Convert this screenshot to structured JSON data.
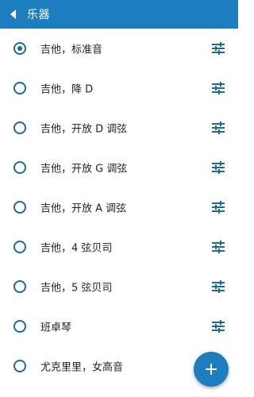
{
  "appbar": {
    "title": "乐器",
    "back_icon": "back-arrow-icon",
    "background": "#1c7dbf"
  },
  "instruments": [
    {
      "label": "吉他，标准音",
      "selected": true
    },
    {
      "label": "吉他，降 D",
      "selected": false
    },
    {
      "label": "吉他，开放 D 调弦",
      "selected": false
    },
    {
      "label": "吉他，开放 G 调弦",
      "selected": false
    },
    {
      "label": "吉他，开放 A 调弦",
      "selected": false
    },
    {
      "label": "吉他，4 弦贝司",
      "selected": false
    },
    {
      "label": "吉他，5 弦贝司",
      "selected": false
    },
    {
      "label": "班卓琴",
      "selected": false
    },
    {
      "label": "尤克里里，女高音",
      "selected": false
    }
  ],
  "row_icon": "tune-icon",
  "fab": {
    "icon": "plus-icon",
    "color": "#1c7dbf"
  },
  "accent_color": "#1b6a9e"
}
